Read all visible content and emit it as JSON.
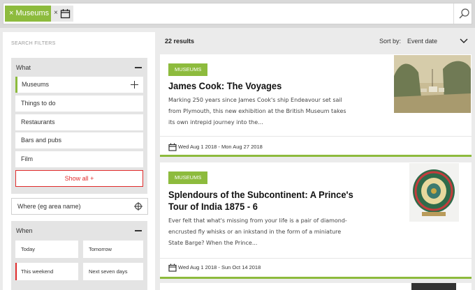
{
  "search": {
    "chip_museums_label": "× Museums",
    "chip_date_remove": "×"
  },
  "filters": {
    "title": "SEARCH FILTERS",
    "what": {
      "heading": "What",
      "options": [
        "Museums",
        "Things to do",
        "Restaurants",
        "Bars and pubs",
        "Film"
      ],
      "show_all": "Show all +"
    },
    "where_placeholder": "Where (eg area name)",
    "when": {
      "heading": "When",
      "options": [
        "Today",
        "Tomorrow",
        "This weekend",
        "Next seven days"
      ]
    }
  },
  "results": {
    "count": "22 results",
    "sort_label": "Sort by:",
    "sort_value": "Event date"
  },
  "cards": [
    {
      "badge": "MUSEUMS",
      "title": "James Cook: The Voyages",
      "desc_lines": [
        "Marking 250 years since James Cook's ship Endeavour set sail",
        "from Plymouth, this new exhibition at the British Museum takes",
        "its own intrepid journey into the..."
      ],
      "date": "Wed Aug 1 2018 - Mon Aug 27 2018"
    },
    {
      "badge": "MUSEUMS",
      "title_lines": [
        "Splendours of the Subcontinent: A Prince's",
        "Tour of India 1875 - 6"
      ],
      "desc_lines": [
        "Ever felt that what's missing from your life is a pair of diamond-",
        "encrusted fly whisks or an inkstand in the form of a miniature",
        "State Barge? When the Prince..."
      ],
      "date": "Wed Aug 1 2018 - Sun Oct 14 2018"
    }
  ],
  "colors": {
    "accent_green": "#8dbb3d",
    "accent_red": "#e02b2b"
  },
  "icons": [
    "close-icon",
    "calendar-icon",
    "search-icon",
    "minus-icon",
    "plus-icon",
    "target-icon",
    "chevron-down-icon"
  ]
}
